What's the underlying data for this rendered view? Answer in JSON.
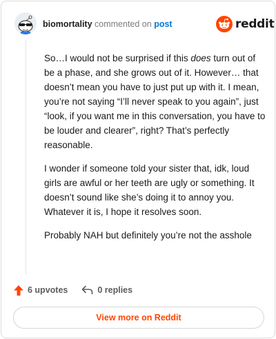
{
  "comment": {
    "username": "biomortality",
    "action_text": "commented on",
    "post_link": "post",
    "paragraphs": [
      {
        "before": "So…I would not be surprised if this ",
        "emphasis": "does",
        "after": " turn out of be a phase, and she grows out of it. However… that doesn’t mean you have to just put up with it. I mean, you’re not saying “I’ll never speak to you again”, just “look, if you want me in this conversation, you have to be louder and clearer”, right? That’s perfectly reasonable."
      },
      {
        "text": "I wonder if someone told your sister that, idk, loud girls are awful or her teeth are ugly or something. It doesn’t sound like she’s doing it to annoy you. Whatever it is, I hope it resolves soon."
      },
      {
        "text": "Probably NAH but definitely you’re not the asshole"
      }
    ]
  },
  "brand": {
    "name": "reddit",
    "color": "#ff4500"
  },
  "footer": {
    "upvotes": "6 upvotes",
    "replies": "0 replies"
  },
  "view_more_label": "View more on Reddit",
  "icons": {
    "avatar": "snoo-sunglasses-avatar",
    "upvote": "upvote-arrow-icon",
    "reply": "reply-arrow-icon",
    "logo": "reddit-snoo-logo"
  }
}
